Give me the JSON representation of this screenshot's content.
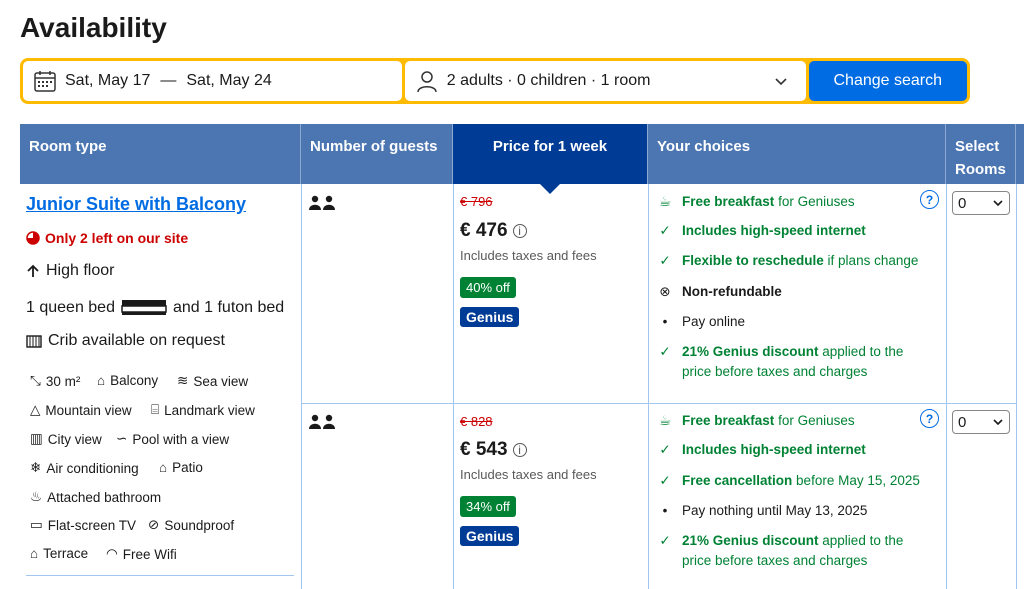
{
  "page_title": "Availability",
  "search": {
    "checkin": "Sat, May 17",
    "separator": "—",
    "checkout": "Sat, May 24",
    "occupancy": "2 adults · 0 children · 1 room",
    "button": "Change search"
  },
  "headers": {
    "room_type": "Room type",
    "guests": "Number of guests",
    "price": "Price for 1 week",
    "choices": "Your choices",
    "select": "Select Rooms"
  },
  "room": {
    "name": "Junior Suite with Balcony",
    "scarcity": "Only 2 left on our site",
    "high_floor": "High floor",
    "bed_1": "1 queen bed",
    "bed_and": "and 1 futon bed",
    "crib": "Crib available on request",
    "facilities": [
      {
        "icon": "area-icon",
        "label": "30 m²"
      },
      {
        "icon": "balcony-icon",
        "label": "Balcony"
      },
      {
        "icon": "sea-view-icon",
        "label": "Sea view"
      },
      {
        "icon": "mountain-icon",
        "label": "Mountain view"
      },
      {
        "icon": "landmark-icon",
        "label": "Landmark view"
      },
      {
        "icon": "city-icon",
        "label": "City view"
      },
      {
        "icon": "pool-icon",
        "label": "Pool with a view"
      },
      {
        "icon": "snowflake-icon",
        "label": "Air conditioning"
      },
      {
        "icon": "patio-icon",
        "label": "Patio"
      },
      {
        "icon": "bath-icon",
        "label": "Attached bathroom"
      },
      {
        "icon": "tv-icon",
        "label": "Flat-screen TV"
      },
      {
        "icon": "soundproof-icon",
        "label": "Soundproof"
      },
      {
        "icon": "terrace-icon",
        "label": "Terrace"
      },
      {
        "icon": "wifi-icon",
        "label": "Free Wifi"
      }
    ]
  },
  "options": [
    {
      "original_price": "€ 796",
      "price": "€ 476",
      "taxes": "Includes taxes and fees",
      "discount": "40% off",
      "genius": "Genius",
      "choices": [
        {
          "strong": "Free breakfast",
          "rest": " for Geniuses"
        },
        {
          "strong": "Includes high-speed internet",
          "rest": ""
        },
        {
          "strong": "Flexible to reschedule",
          "rest": " if plans change"
        },
        {
          "strong": "Non-refundable",
          "rest": ""
        },
        {
          "strong": "",
          "rest": "Pay online"
        },
        {
          "strong": "21% Genius discount",
          "rest": " applied to the price before taxes and charges"
        }
      ],
      "select_value": "0"
    },
    {
      "original_price": "€ 828",
      "price": "€ 543",
      "taxes": "Includes taxes and fees",
      "discount": "34% off",
      "genius": "Genius",
      "choices": [
        {
          "strong": "Free breakfast",
          "rest": " for Geniuses"
        },
        {
          "strong": "Includes high-speed internet",
          "rest": ""
        },
        {
          "strong": "Free cancellation",
          "rest": " before May 15, 2025"
        },
        {
          "strong": "",
          "rest": "Pay nothing until May 13, 2025"
        },
        {
          "strong": "21% Genius discount",
          "rest": " applied to the price before taxes and charges"
        }
      ],
      "select_value": "0"
    }
  ],
  "colors": {
    "brand_blue": "#006ce4",
    "header_blue": "#4c76b2",
    "dark_blue": "#003b95",
    "green": "#008234",
    "yellow": "#febb02",
    "red": "#cc0000"
  }
}
